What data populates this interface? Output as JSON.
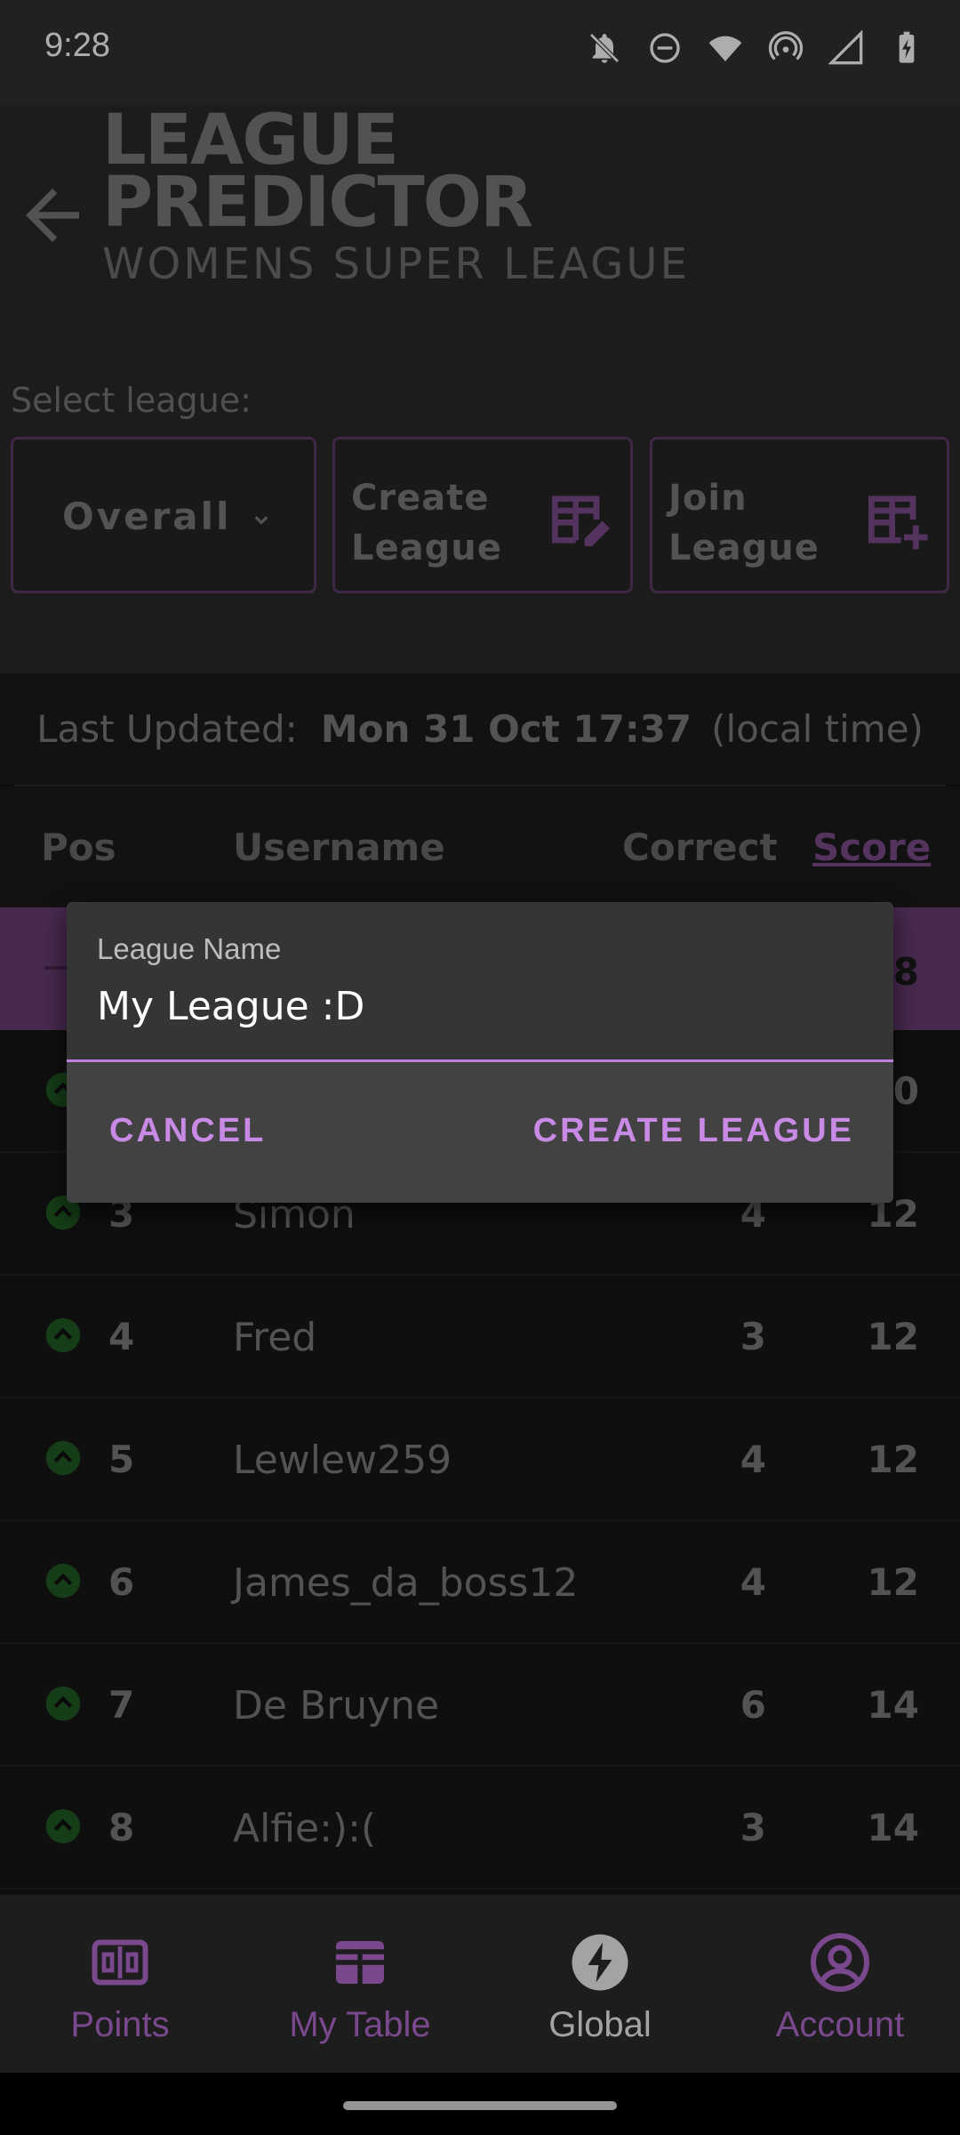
{
  "status_bar": {
    "time": "9:28",
    "icons": [
      "notifications-off-icon",
      "do-not-disturb-icon",
      "wifi-icon",
      "hotspot-icon",
      "signal-icon",
      "battery-charging-icon"
    ]
  },
  "header": {
    "back_icon": "arrow-left-icon",
    "logo_line1": "LEAGUE",
    "logo_line2": "PREDICTOR",
    "logo_sub": "WOMENS SUPER LEAGUE"
  },
  "league_select": {
    "label": "Select league:",
    "dropdown_value": "Overall",
    "create_label_1": "Create",
    "create_label_2": "League",
    "join_label_1": "Join",
    "join_label_2": "League"
  },
  "last_updated": {
    "label": "Last Updated:",
    "value": "Mon 31 Oct 17:37",
    "suffix": "(local time)"
  },
  "table": {
    "headers": {
      "pos": "Pos",
      "username": "Username",
      "correct": "Correct",
      "score": "Score"
    },
    "highlight_row_score": "8",
    "row2_score": "0",
    "rows": [
      {
        "pos": "3",
        "username": "Simon",
        "correct": "4",
        "score": "12"
      },
      {
        "pos": "4",
        "username": "Fred",
        "correct": "3",
        "score": "12"
      },
      {
        "pos": "5",
        "username": "Lewlew259",
        "correct": "4",
        "score": "12"
      },
      {
        "pos": "6",
        "username": "James_da_boss12",
        "correct": "4",
        "score": "12"
      },
      {
        "pos": "7",
        "username": "De Bruyne",
        "correct": "6",
        "score": "14"
      },
      {
        "pos": "8",
        "username": "Alfie:):(",
        "correct": "3",
        "score": "14"
      }
    ]
  },
  "dialog": {
    "field_label": "League Name",
    "field_value": "My League :D",
    "cancel_label": "CANCEL",
    "create_label": "CREATE LEAGUE"
  },
  "bottom_nav": {
    "items": [
      {
        "label": "Points",
        "icon": "scoreboard-icon",
        "active": false
      },
      {
        "label": "My Table",
        "icon": "table-icon",
        "active": false
      },
      {
        "label": "Global",
        "icon": "bolt-icon",
        "active": true
      },
      {
        "label": "Account",
        "icon": "account-circle-icon",
        "active": false
      }
    ]
  },
  "colors": {
    "accent_purple": "#b46ad0",
    "highlight_row": "#6a3f75",
    "up_indicator": "#1f5a22"
  }
}
